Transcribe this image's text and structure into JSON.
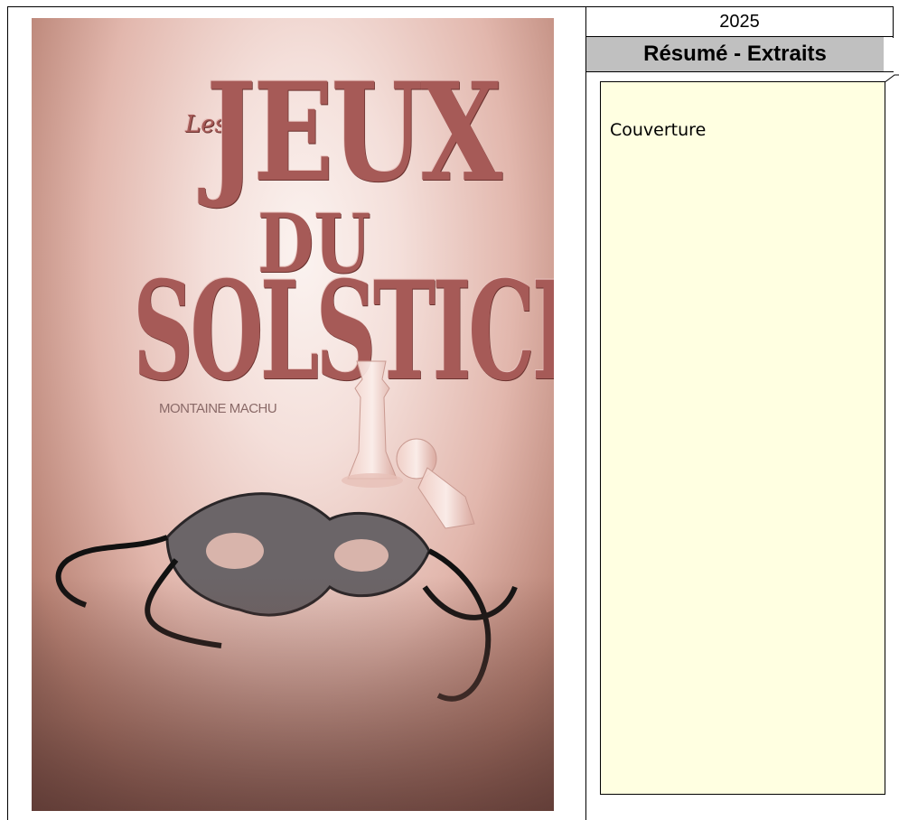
{
  "sheet": {
    "year": "2025",
    "header": "Résumé - Extraits"
  },
  "comment": {
    "text": "Couverture"
  },
  "cover": {
    "title_les": "Les",
    "title_jeux": "JEUX",
    "title_du": "DU",
    "title_solstice": "SOLSTICE",
    "author": "MONTAINE MACHU"
  },
  "colors": {
    "header_bg": "#c0c0c0",
    "comment_bg": "#ffffe1",
    "title_rose": "#a65a57"
  }
}
